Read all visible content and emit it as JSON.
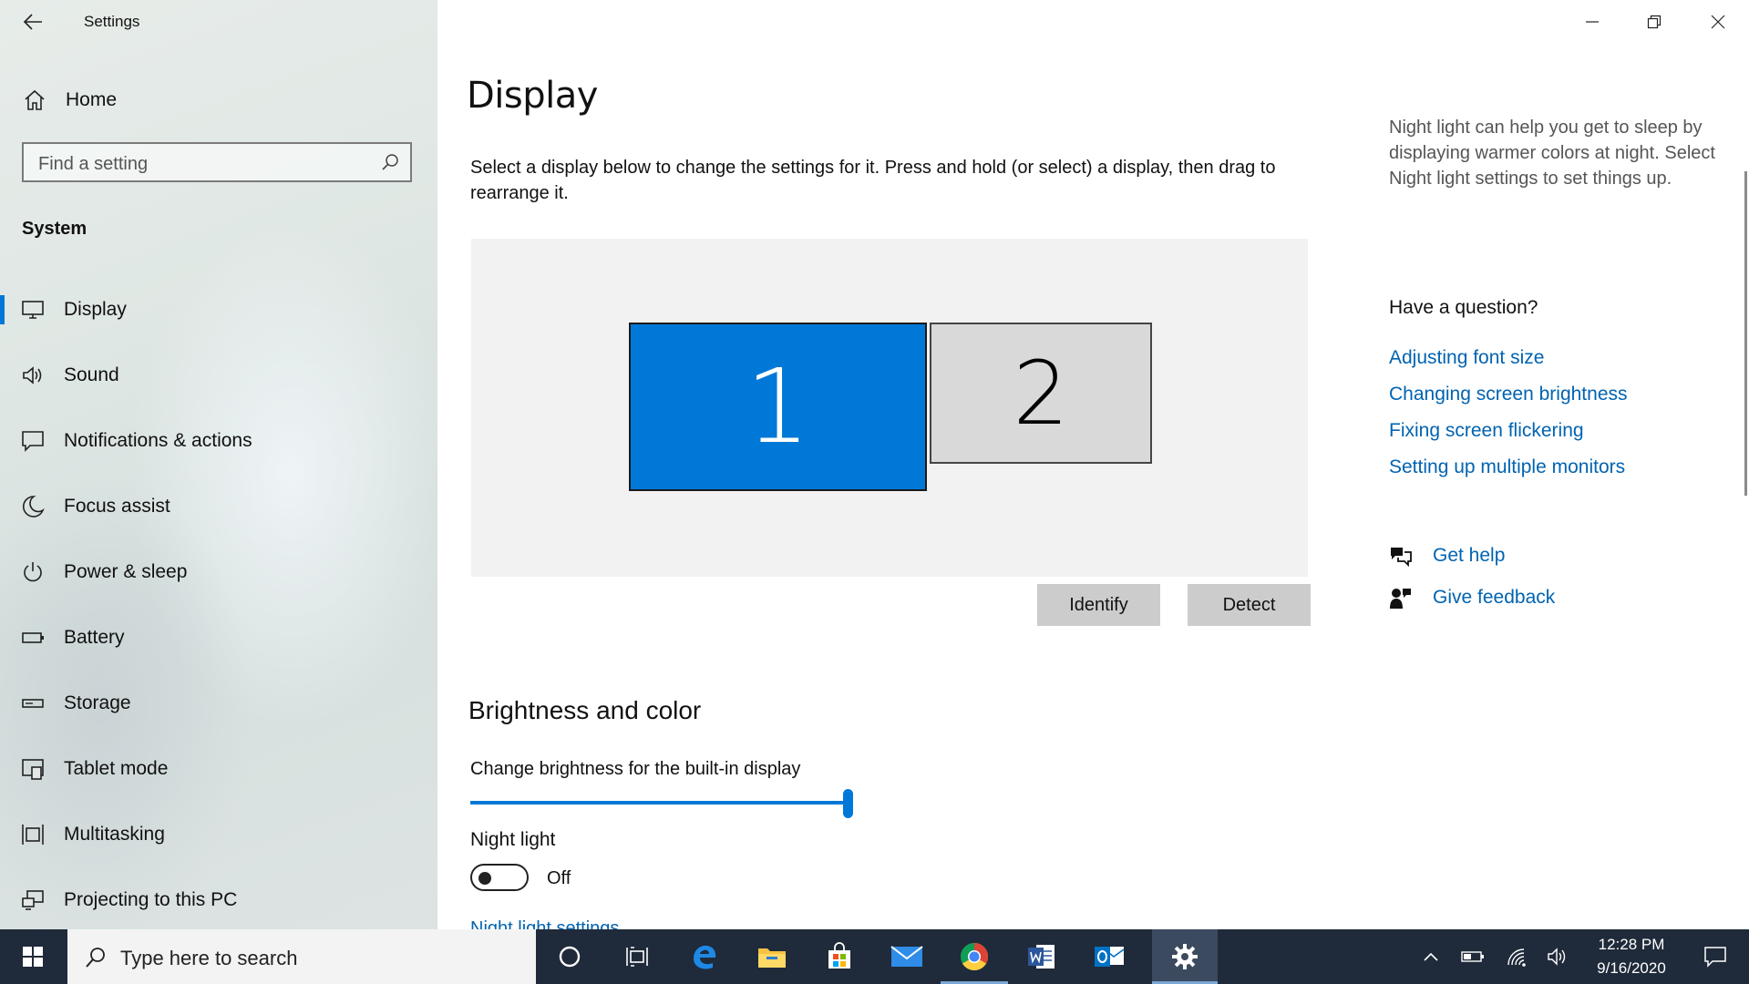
{
  "window": {
    "app_title": "Settings",
    "controls": [
      "minimize",
      "restore",
      "close"
    ]
  },
  "sidebar": {
    "home_label": "Home",
    "search_placeholder": "Find a setting",
    "section_label": "System",
    "items": [
      {
        "label": "Display",
        "icon": "monitor-icon",
        "selected": true
      },
      {
        "label": "Sound",
        "icon": "speaker-icon"
      },
      {
        "label": "Notifications & actions",
        "icon": "notification-icon"
      },
      {
        "label": "Focus assist",
        "icon": "moon-icon"
      },
      {
        "label": "Power & sleep",
        "icon": "power-icon"
      },
      {
        "label": "Battery",
        "icon": "battery-icon"
      },
      {
        "label": "Storage",
        "icon": "storage-icon"
      },
      {
        "label": "Tablet mode",
        "icon": "tablet-icon"
      },
      {
        "label": "Multitasking",
        "icon": "multitasking-icon"
      },
      {
        "label": "Projecting to this PC",
        "icon": "projecting-icon"
      }
    ]
  },
  "main": {
    "title": "Display",
    "description": "Select a display below to change the settings for it. Press and hold (or select) a display, then drag to rearrange it.",
    "monitors": [
      {
        "number": "1",
        "selected": true
      },
      {
        "number": "2",
        "selected": false
      }
    ],
    "identify_label": "Identify",
    "detect_label": "Detect",
    "brightness_section": "Brightness and color",
    "brightness_label": "Change brightness for the built-in display",
    "brightness_value": 1.0,
    "night_light_label": "Night light",
    "night_light_state": "Off",
    "night_light_on": false,
    "night_light_settings_link": "Night light settings"
  },
  "right_panel": {
    "night_light_note": "Night light can help you get to sleep by displaying warmer colors at night. Select Night light settings to set things up.",
    "question_heading": "Have a question?",
    "links": [
      "Adjusting font size",
      "Changing screen brightness",
      "Fixing screen flickering",
      "Setting up multiple monitors"
    ],
    "get_help": "Get help",
    "give_feedback": "Give feedback"
  },
  "taskbar": {
    "search_placeholder": "Type here to search",
    "apps": [
      "cortana",
      "task-view",
      "edge",
      "file-explorer",
      "store",
      "mail",
      "chrome",
      "word",
      "outlook",
      "settings"
    ],
    "time": "12:28 PM",
    "date": "9/16/2020"
  },
  "colors": {
    "accent": "#0078d7",
    "link": "#0063b1",
    "taskbar": "#1f2a3a"
  }
}
